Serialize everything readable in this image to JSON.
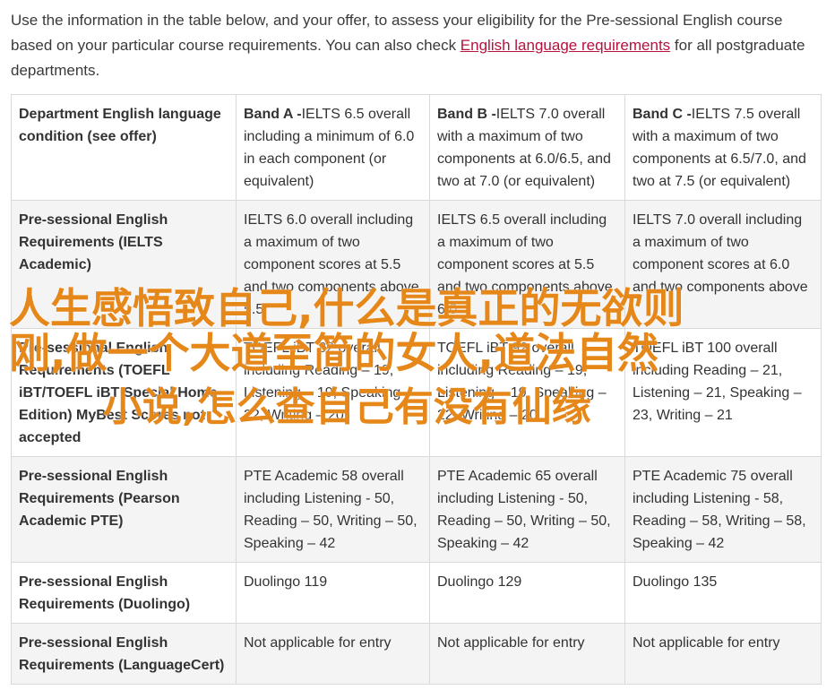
{
  "intro": {
    "text_before": "Use the information in the table below, and your offer, to assess your eligibility for the Pre-sessional English course based on your particular course requirements. You can also check ",
    "link": "English language requirements",
    "text_after": " for all postgraduate departments."
  },
  "table": {
    "header": {
      "label": "Department English language condition (see offer)",
      "bands": [
        {
          "name": "Band A -",
          "detail": "IELTS 6.5 overall including a minimum of 6.0 in each component (or equivalent)"
        },
        {
          "name": "Band B -",
          "detail": "IELTS 7.0 overall with a maximum of two components at 6.0/6.5, and two at 7.0 (or equivalent)"
        },
        {
          "name": "Band C -",
          "detail": "IELTS 7.5 overall with a maximum of two components at 6.5/7.0, and two at 7.5 (or equivalent)"
        }
      ]
    },
    "rows": [
      {
        "label": "Pre-sessional English Requirements (IELTS Academic)",
        "values": [
          "IELTS 6.0 overall including a maximum of two component scores at 5.5 and two components above 5.5",
          "IELTS 6.5 overall including a maximum of two component scores at 5.5 and two components above 6.0",
          "IELTS 7.0 overall including a maximum of two component scores at 6.0 and two components above"
        ]
      },
      {
        "label": "Pre-sessional English Requirements (TOEFL iBT/TOEFL iBT Special Home Edition) MyBest Scores not accepted",
        "values": [
          "TOEFL iBT 82 overall including Reading – 19, Listening – 19, Speaking – 22, Writing – 20",
          "TOEFL iBT 92 overall including Reading – 19, Listening – 19, Speaking – 22, Writing – 20",
          "TOEFL iBT 100 overall including Reading – 21, Listening – 21, Speaking – 23, Writing – 21"
        ]
      },
      {
        "label": "Pre-sessional English Requirements (Pearson Academic PTE)",
        "values": [
          "PTE Academic 58 overall including Listening - 50, Reading – 50, Writing – 50, Speaking – 42",
          "PTE Academic 65 overall including Listening - 50, Reading – 50, Writing – 50, Speaking – 42",
          "PTE Academic 75 overall including Listening - 58, Reading – 58, Writing – 58, Speaking – 42"
        ]
      },
      {
        "label": "Pre-sessional English Requirements (Duolingo)",
        "values": [
          "Duolingo 119",
          "Duolingo 129",
          "Duolingo 135"
        ]
      },
      {
        "label": "Pre-sessional English Requirements (LanguageCert)",
        "values": [
          "Not applicable for entry",
          "Not applicable for entry",
          "Not applicable for entry"
        ]
      }
    ]
  },
  "overlay": {
    "line1": "人生感悟致自己,什么是真正的无欲则",
    "line2": "刚,做一个大道至简的女人,道法自然",
    "line3": "小说,怎么查自己有没有仙缘"
  },
  "colors": {
    "link": "#b5123e",
    "overlay_text": "#e6871a",
    "border": "#d9d9d9",
    "shaded_row": "#f4f4f4"
  }
}
